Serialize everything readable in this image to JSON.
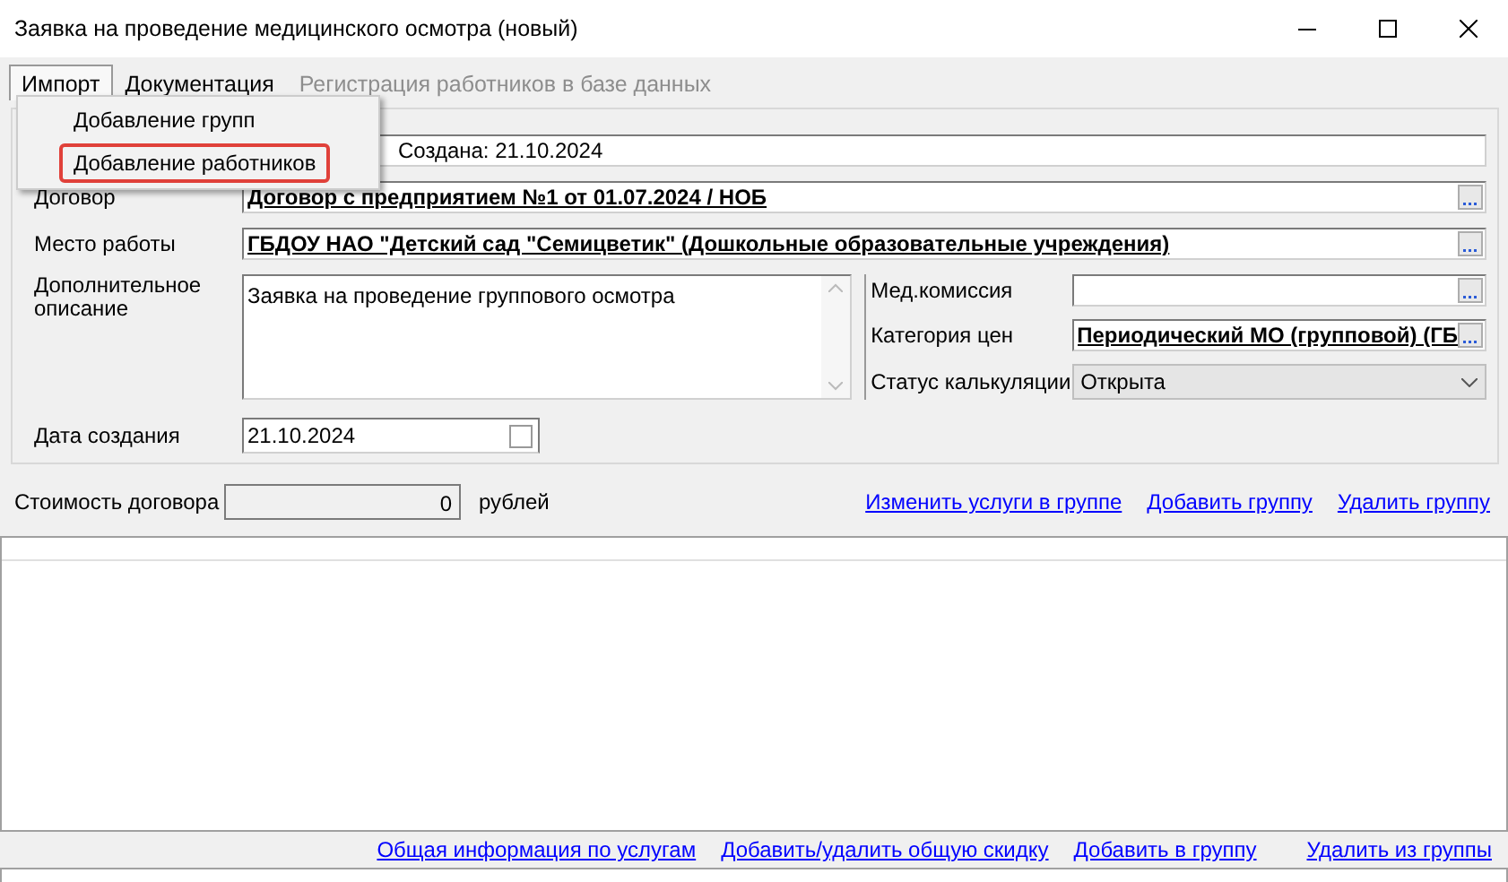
{
  "window": {
    "title": "Заявка на проведение медицинского осмотра (новый)"
  },
  "menu": [
    {
      "label": "Импорт",
      "selected": true,
      "disabled": false
    },
    {
      "label": "Документация",
      "selected": false,
      "disabled": false
    },
    {
      "label": "Регистрация работников в базе данных",
      "selected": false,
      "disabled": true
    }
  ],
  "import_menu": {
    "items": [
      {
        "label": "Добавление групп",
        "highlighted": false
      },
      {
        "label": "Добавление работников",
        "highlighted": true
      }
    ]
  },
  "header_field": {
    "value": "Создана: 21.10.2024"
  },
  "form": {
    "contract": {
      "label": "Договор",
      "value": "Договор с предприятием №1 от 01.07.2024 / НОБ"
    },
    "workplace": {
      "label": "Место работы",
      "value": "ГБДОУ НАО \"Детский сад \"Семицветик\" (Дошкольные образовательные учреждения)"
    },
    "description": {
      "label": "Дополнительное описание",
      "value": "Заявка на проведение группового осмотра"
    },
    "created_date": {
      "label": "Дата создания",
      "value": "21.10.2024",
      "checked": false
    },
    "med_commission": {
      "label": "Мед.комиссия"
    },
    "price_category": {
      "label": "Категория цен",
      "value": "Периодический МО (групповой) (ГБ"
    },
    "calc_status": {
      "label": "Статус калькуляции",
      "value": "Открыта"
    }
  },
  "cost": {
    "label": "Стоимость договора",
    "value": "0",
    "unit": "рублей"
  },
  "group_links": [
    "Изменить услуги в группе",
    "Добавить группу",
    "Удалить группу"
  ],
  "bottom_links": [
    "Общая информация по услугам",
    "Добавить/удалить общую скидку",
    "Добавить в группу",
    "Удалить из группы"
  ]
}
